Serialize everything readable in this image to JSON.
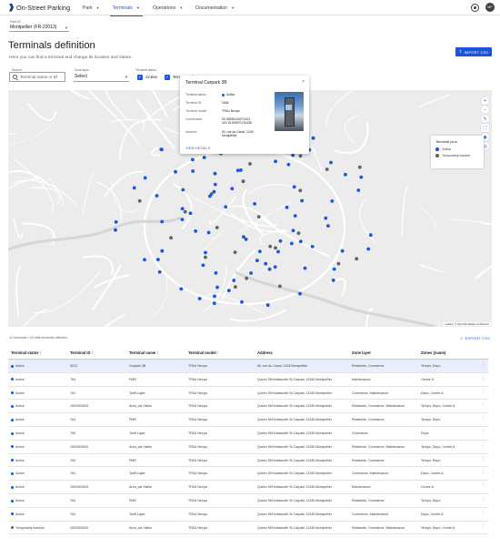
{
  "app": {
    "logo_text": "On-Street Parking"
  },
  "nav": [
    {
      "label": "Park",
      "active": false
    },
    {
      "label": "Terminals",
      "active": true
    },
    {
      "label": "Operations",
      "active": false
    },
    {
      "label": "Documentation",
      "active": false
    }
  ],
  "user": {
    "initials": "MP"
  },
  "park": {
    "label": "Park ID",
    "value": "Montpellier (FR-22013)"
  },
  "page": {
    "title": "Terminals definition",
    "subtitle": "Here you can find a terminal and change its location and status.",
    "import_label": "IMPORT CSV"
  },
  "filters": {
    "search_label": "Search",
    "search_placeholder": "Terminal name or ID",
    "zone_label": "Zone layer",
    "zone_value": "Select",
    "status_label": "Terminal status",
    "active_label": "Active",
    "inactive_label": "Temporarily inactive"
  },
  "colors": {
    "accent": "#1a56db",
    "active": "#1a56db",
    "inactive": "#5f6368"
  },
  "map": {
    "legend_title": "Terminal pins",
    "legend_active": "Active",
    "legend_inactive": "Temporarily inactive",
    "attribution": "Leaflet | © OpenStreetMap contributors",
    "controls": [
      "plus-icon",
      "minus-icon",
      "edit-icon",
      "fullscreen-icon",
      "layers-icon",
      "location-icon"
    ]
  },
  "popup": {
    "title": "Terminal Carpark 3B",
    "rows": [
      {
        "key": "Terminal status",
        "value": "Active"
      },
      {
        "key": "Terminal ID",
        "value": "1604"
      },
      {
        "key": "Terminal model",
        "value": "TPAU Nexpa"
      },
      {
        "key": "Coordinates",
        "value": "50.05535140271421 119.15193970176436"
      },
      {
        "key": "Address",
        "value": "50, rue du Canal, 1245 Montpellier"
      }
    ],
    "link": "VIEW DETAILS"
  },
  "table": {
    "info": "12 terminals / 43 total terminals affected",
    "export_label": "EXPORT CSV",
    "columns": [
      "Terminal status",
      "Terminal ID",
      "Terminal name",
      "Terminal model",
      "Address",
      "Zone layer",
      "Zones (name)"
    ],
    "rows": [
      {
        "status": "Active",
        "id": "5213",
        "name": "Carpark 3B",
        "model": "TPAU Nexpa",
        "address": "50, rue du Canal, 1245 Montpellier",
        "zone_layer": "Residents, Commerce",
        "zones": "Tempo, Depo"
      },
      {
        "status": "Active",
        "id": "764",
        "name": "PMR",
        "model": "TPAU Nexpa",
        "address": "Queen St/Holdsworth St Carpark 12345 Montpellier",
        "zone_layer": "Maintenance",
        "zones": "Centre A"
      },
      {
        "status": "Active",
        "id": "764",
        "name": "Tariff Layer",
        "model": "TPAU Nexpa",
        "address": "Queen St/Holdsworth St Carpark 12345 Montpellier",
        "zone_layer": "Commerce, Maintenance",
        "zones": "Depo, Centre A"
      },
      {
        "status": "Active",
        "id": "1502903003",
        "name": "Area_cat Visitor",
        "model": "TPAU Nexpa",
        "address": "Queen St/Holdsworth St Carpark 12345 Montpellier",
        "zone_layer": "Residents, Commerce, Maintenance",
        "zones": "Tempo, Depo, Centre A"
      },
      {
        "status": "Active",
        "id": "764",
        "name": "PMR",
        "model": "TPAU Nexpa",
        "address": "Queen St/Holdsworth St Carpark 12345 Montpellier",
        "zone_layer": "Residents, Commerce",
        "zones": "Tempo, Depo"
      },
      {
        "status": "Active",
        "id": "764",
        "name": "Tariff Layer",
        "model": "TPAU Nexpa",
        "address": "Queen St/Holdsworth St Carpark 12345 Montpellier",
        "zone_layer": "Commerce",
        "zones": "Depo"
      },
      {
        "status": "Active",
        "id": "1502903003",
        "name": "Area_cat Visitor",
        "model": "TPAU Nexpa",
        "address": "Queen St/Holdsworth St Carpark 12345 Montpellier",
        "zone_layer": "Residents, Commerce, Maintenance",
        "zones": "Tempo, Depo, Centre A"
      },
      {
        "status": "Active",
        "id": "764",
        "name": "PMR",
        "model": "TPAU Nexpa",
        "address": "Queen St/Holdsworth St Carpark 12345 Montpellier",
        "zone_layer": "Residents, Commerce",
        "zones": "Tempo, Depo"
      },
      {
        "status": "Active",
        "id": "764",
        "name": "Tariff Layer",
        "model": "TPAU Nexpa",
        "address": "Queen St/Holdsworth St Carpark 12345 Montpellier",
        "zone_layer": "Commerce, Maintenance",
        "zones": "Depo, Centre A"
      },
      {
        "status": "Active",
        "id": "1502903003",
        "name": "Area_cat Visitor",
        "model": "TPAU Nexpa",
        "address": "Queen St/Holdsworth St Carpark 12345 Montpellier",
        "zone_layer": "Maintenance",
        "zones": "Centre A"
      },
      {
        "status": "Active",
        "id": "764",
        "name": "PMR",
        "model": "TPAU Nexpa",
        "address": "Queen St/Holdsworth St Carpark 12345 Montpellier",
        "zone_layer": "Residents, Commerce",
        "zones": "Tempo, Depo"
      },
      {
        "status": "Active",
        "id": "764",
        "name": "Tariff Layer",
        "model": "TPAU Nexpa",
        "address": "Queen St/Holdsworth St Carpark 12345 Montpellier",
        "zone_layer": "Commerce, Maintenance",
        "zones": "Depo, Centre A"
      },
      {
        "status": "Temporarily inactive",
        "id": "1502903003",
        "name": "Area_cat Visitor",
        "model": "TPAU Nexpa",
        "address": "Queen St/Holdsworth St Carpark 12345 Montpellier",
        "zone_layer": "Residents, Commerce, Maintenance",
        "zones": "Tempo, Depo, Centre A"
      }
    ]
  }
}
